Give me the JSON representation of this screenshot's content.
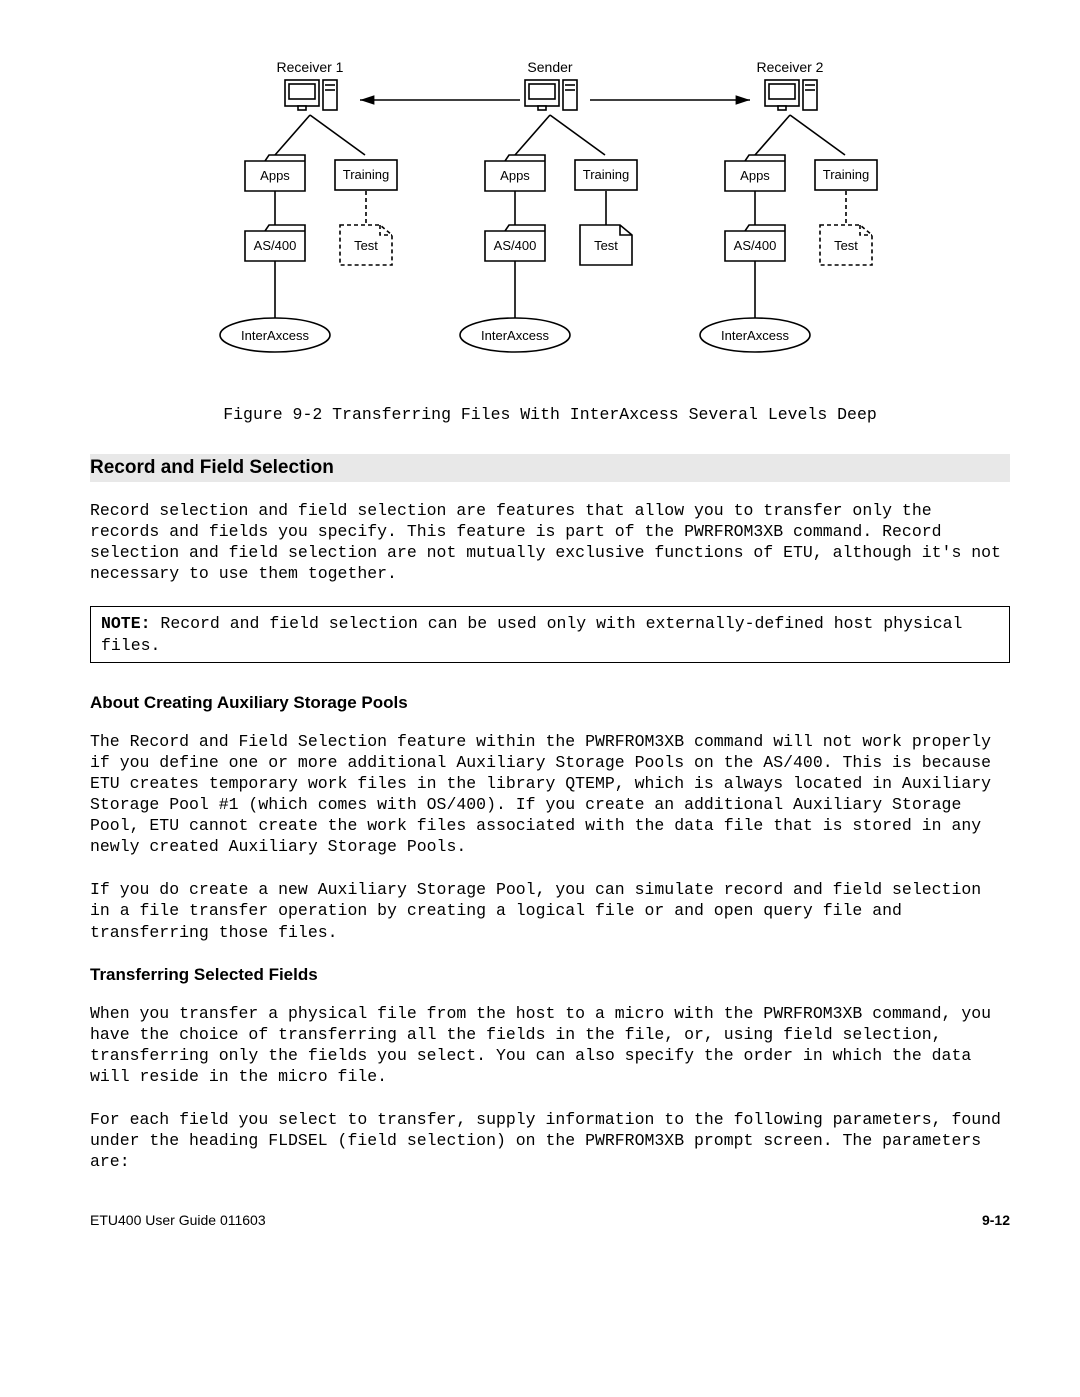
{
  "diagram": {
    "top_labels": [
      "Receiver 1",
      "Sender",
      "Receiver 2"
    ],
    "box_apps": "Apps",
    "box_training": "Training",
    "box_as400": "AS/400",
    "box_test": "Test",
    "ellipse": "InterAxcess"
  },
  "caption": "Figure 9-2 Transferring Files With InterAxcess Several Levels Deep",
  "section_title": "Record and Field Selection",
  "para1": "Record selection and field selection are features that allow you to transfer only the records and fields you specify. This feature is part of the PWRFROM3XB command. Record selection and field selection are not mutually exclusive functions of ETU, although it's not necessary to use them together.",
  "note_label": "NOTE:",
  "note_text": " Record and field selection can be used only with externally-defined host physical files.",
  "sub1": "About Creating Auxiliary Storage Pools",
  "para2": "The Record and Field Selection feature within the PWRFROM3XB command will not work properly if you define one or more additional Auxiliary Storage Pools on the AS/400.  This is because ETU creates temporary work files in the library QTEMP, which is always located in Auxiliary Storage Pool #1 (which comes with OS/400).  If you create an additional Auxiliary Storage Pool, ETU cannot create the work files associated with the data file that is stored in any newly created Auxiliary Storage Pools.",
  "para3": "If you do create a new Auxiliary Storage Pool, you can simulate record and field selection in a file transfer operation by creating a logical file or and open query file and transferring those files.",
  "sub2": "Transferring Selected Fields",
  "para4": "When you transfer a physical file from the host to a micro with the PWRFROM3XB command, you have the choice of transferring all the fields in the file, or, using field selection, transferring only the fields you select. You can also specify the order in which the data will reside in the micro file.",
  "para5": "For each field you select to transfer, supply information to the following parameters, found under the heading FLDSEL (field selection) on the PWRFROM3XB prompt screen. The parameters are:",
  "footer_left": "ETU400 User Guide 011603",
  "footer_right": "9-12"
}
